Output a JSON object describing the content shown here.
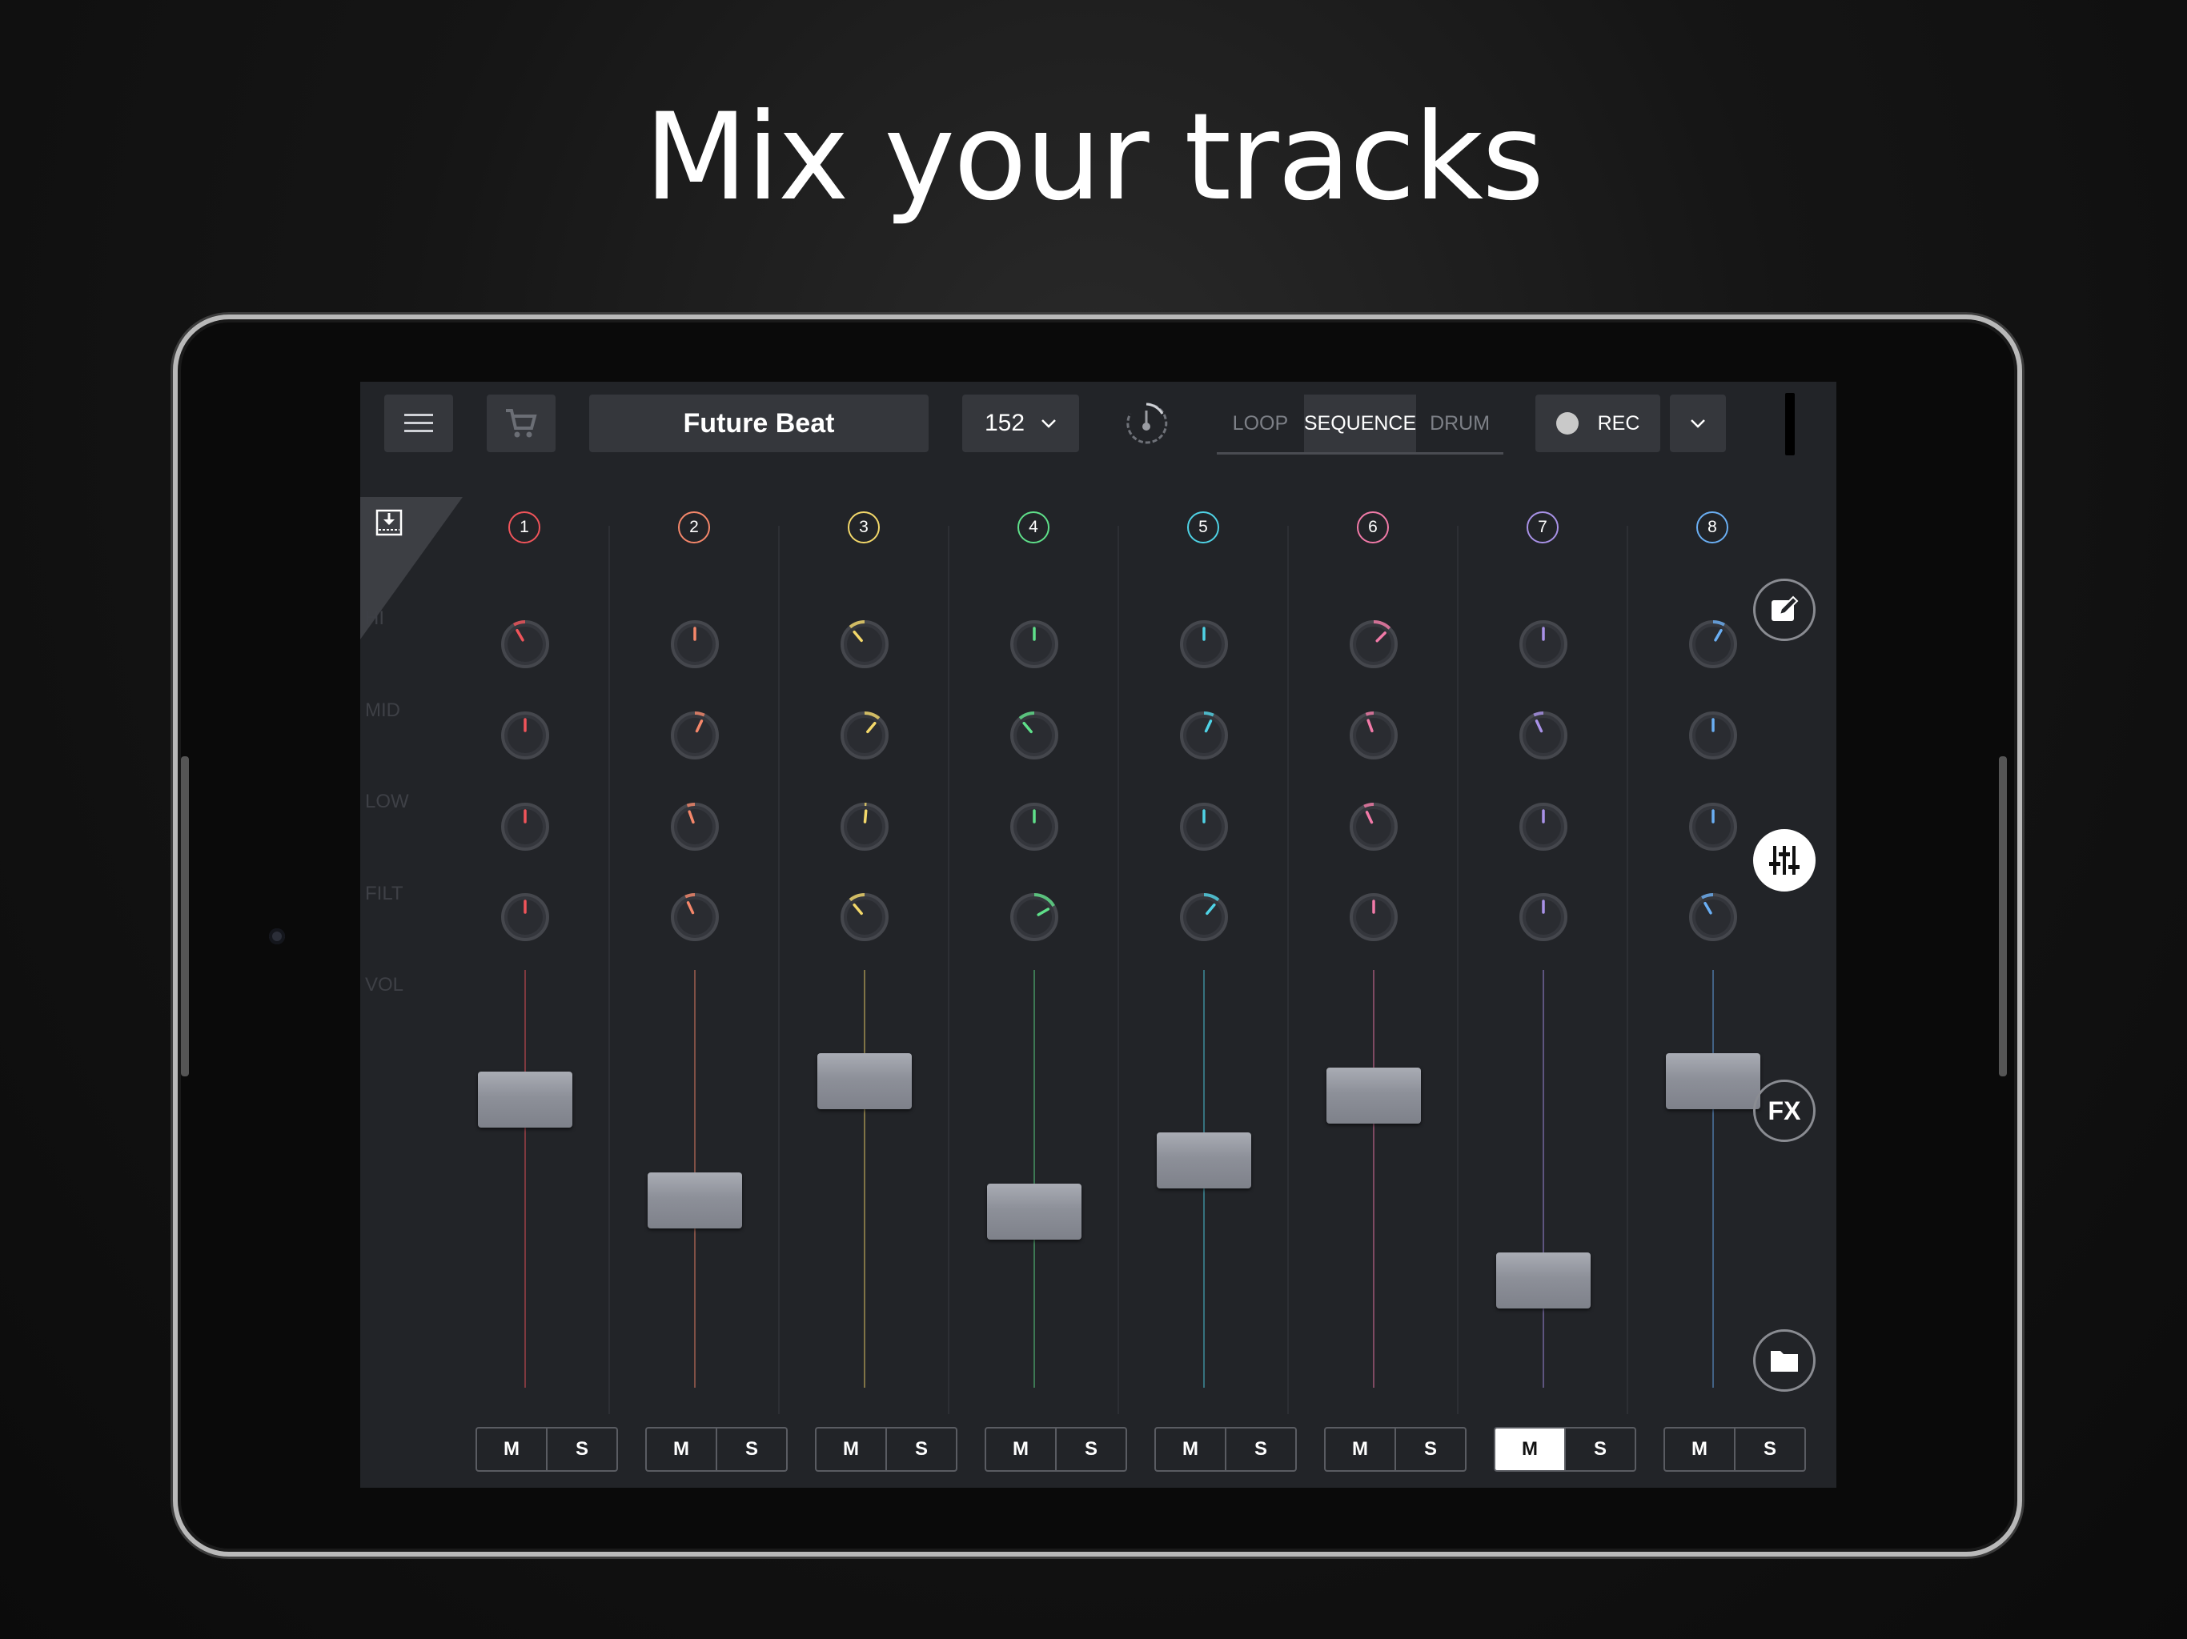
{
  "headline": "Mix your tracks",
  "header": {
    "project_name": "Future Beat",
    "bpm": "152",
    "modes": [
      "LOOP",
      "SEQUENCE",
      "DRUM"
    ],
    "active_mode": "SEQUENCE",
    "rec_label": "REC"
  },
  "row_labels": [
    "HI",
    "MID",
    "LOW",
    "FILT",
    "VOL"
  ],
  "mute_label": "M",
  "solo_label": "S",
  "channels": [
    {
      "number": "1",
      "color": "#f0545a",
      "knobs": [
        -30,
        0,
        0,
        0
      ],
      "volume": 0.72,
      "muted": false
    },
    {
      "number": "2",
      "color": "#f5876a",
      "knobs": [
        0,
        25,
        -20,
        -25
      ],
      "volume": 0.44,
      "muted": false
    },
    {
      "number": "3",
      "color": "#f3d86a",
      "knobs": [
        -40,
        40,
        5,
        -40
      ],
      "volume": 0.77,
      "muted": false
    },
    {
      "number": "4",
      "color": "#5fe08a",
      "knobs": [
        0,
        -40,
        0,
        60
      ],
      "volume": 0.41,
      "muted": false
    },
    {
      "number": "5",
      "color": "#4fd3e6",
      "knobs": [
        0,
        25,
        0,
        40
      ],
      "volume": 0.55,
      "muted": false
    },
    {
      "number": "6",
      "color": "#f27aa8",
      "knobs": [
        45,
        -20,
        -25,
        0
      ],
      "volume": 0.73,
      "muted": false
    },
    {
      "number": "7",
      "color": "#a992e8",
      "knobs": [
        0,
        -25,
        0,
        0
      ],
      "volume": 0.22,
      "muted": true
    },
    {
      "number": "8",
      "color": "#6aaef3",
      "knobs": [
        30,
        0,
        0,
        -30
      ],
      "volume": 0.77,
      "muted": false
    }
  ],
  "side_buttons": [
    "edit-icon",
    "mixer-icon",
    "fx-icon",
    "folder-icon"
  ],
  "fx_label": "FX"
}
